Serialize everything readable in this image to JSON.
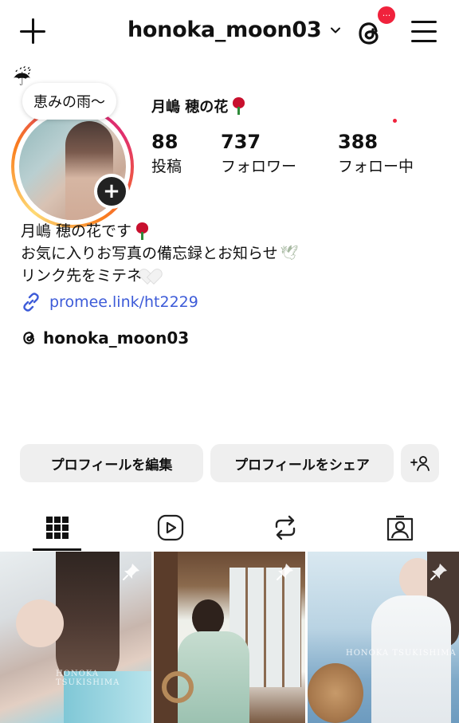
{
  "header": {
    "username": "honoka_moon03",
    "notification_badge": "···",
    "colors": {
      "badge": "#f0223c"
    }
  },
  "profile": {
    "note": "恵みの雨〜",
    "note_emoji": "☔",
    "display_name": "月嶋 穂の花",
    "stats": [
      {
        "value": "88",
        "label": "投稿"
      },
      {
        "value": "737",
        "label": "フォロワー"
      },
      {
        "value": "388",
        "label": "フォロー中"
      }
    ],
    "bio": [
      "月嶋 穂の花です",
      "お気に入りお写真の備忘録とお知らせ",
      "リンク先をミテネ"
    ],
    "link": "promee.link/ht2229",
    "threads_handle": "honoka_moon03",
    "colors": {
      "link": "#3d5bd8"
    }
  },
  "actions": {
    "edit_profile": "プロフィールを編集",
    "share_profile": "プロフィールをシェア"
  },
  "tabs": [
    {
      "icon": "grid-icon",
      "active": true
    },
    {
      "icon": "reels-icon",
      "active": false
    },
    {
      "icon": "repost-icon",
      "active": false
    },
    {
      "icon": "tagged-icon",
      "active": false
    }
  ],
  "posts": [
    {
      "pinned": true,
      "watermark": "HONOKA TSUKISHIMA"
    },
    {
      "pinned": true,
      "watermark": ""
    },
    {
      "pinned": true,
      "watermark": "HONOKA TSUKISHIMA"
    }
  ]
}
